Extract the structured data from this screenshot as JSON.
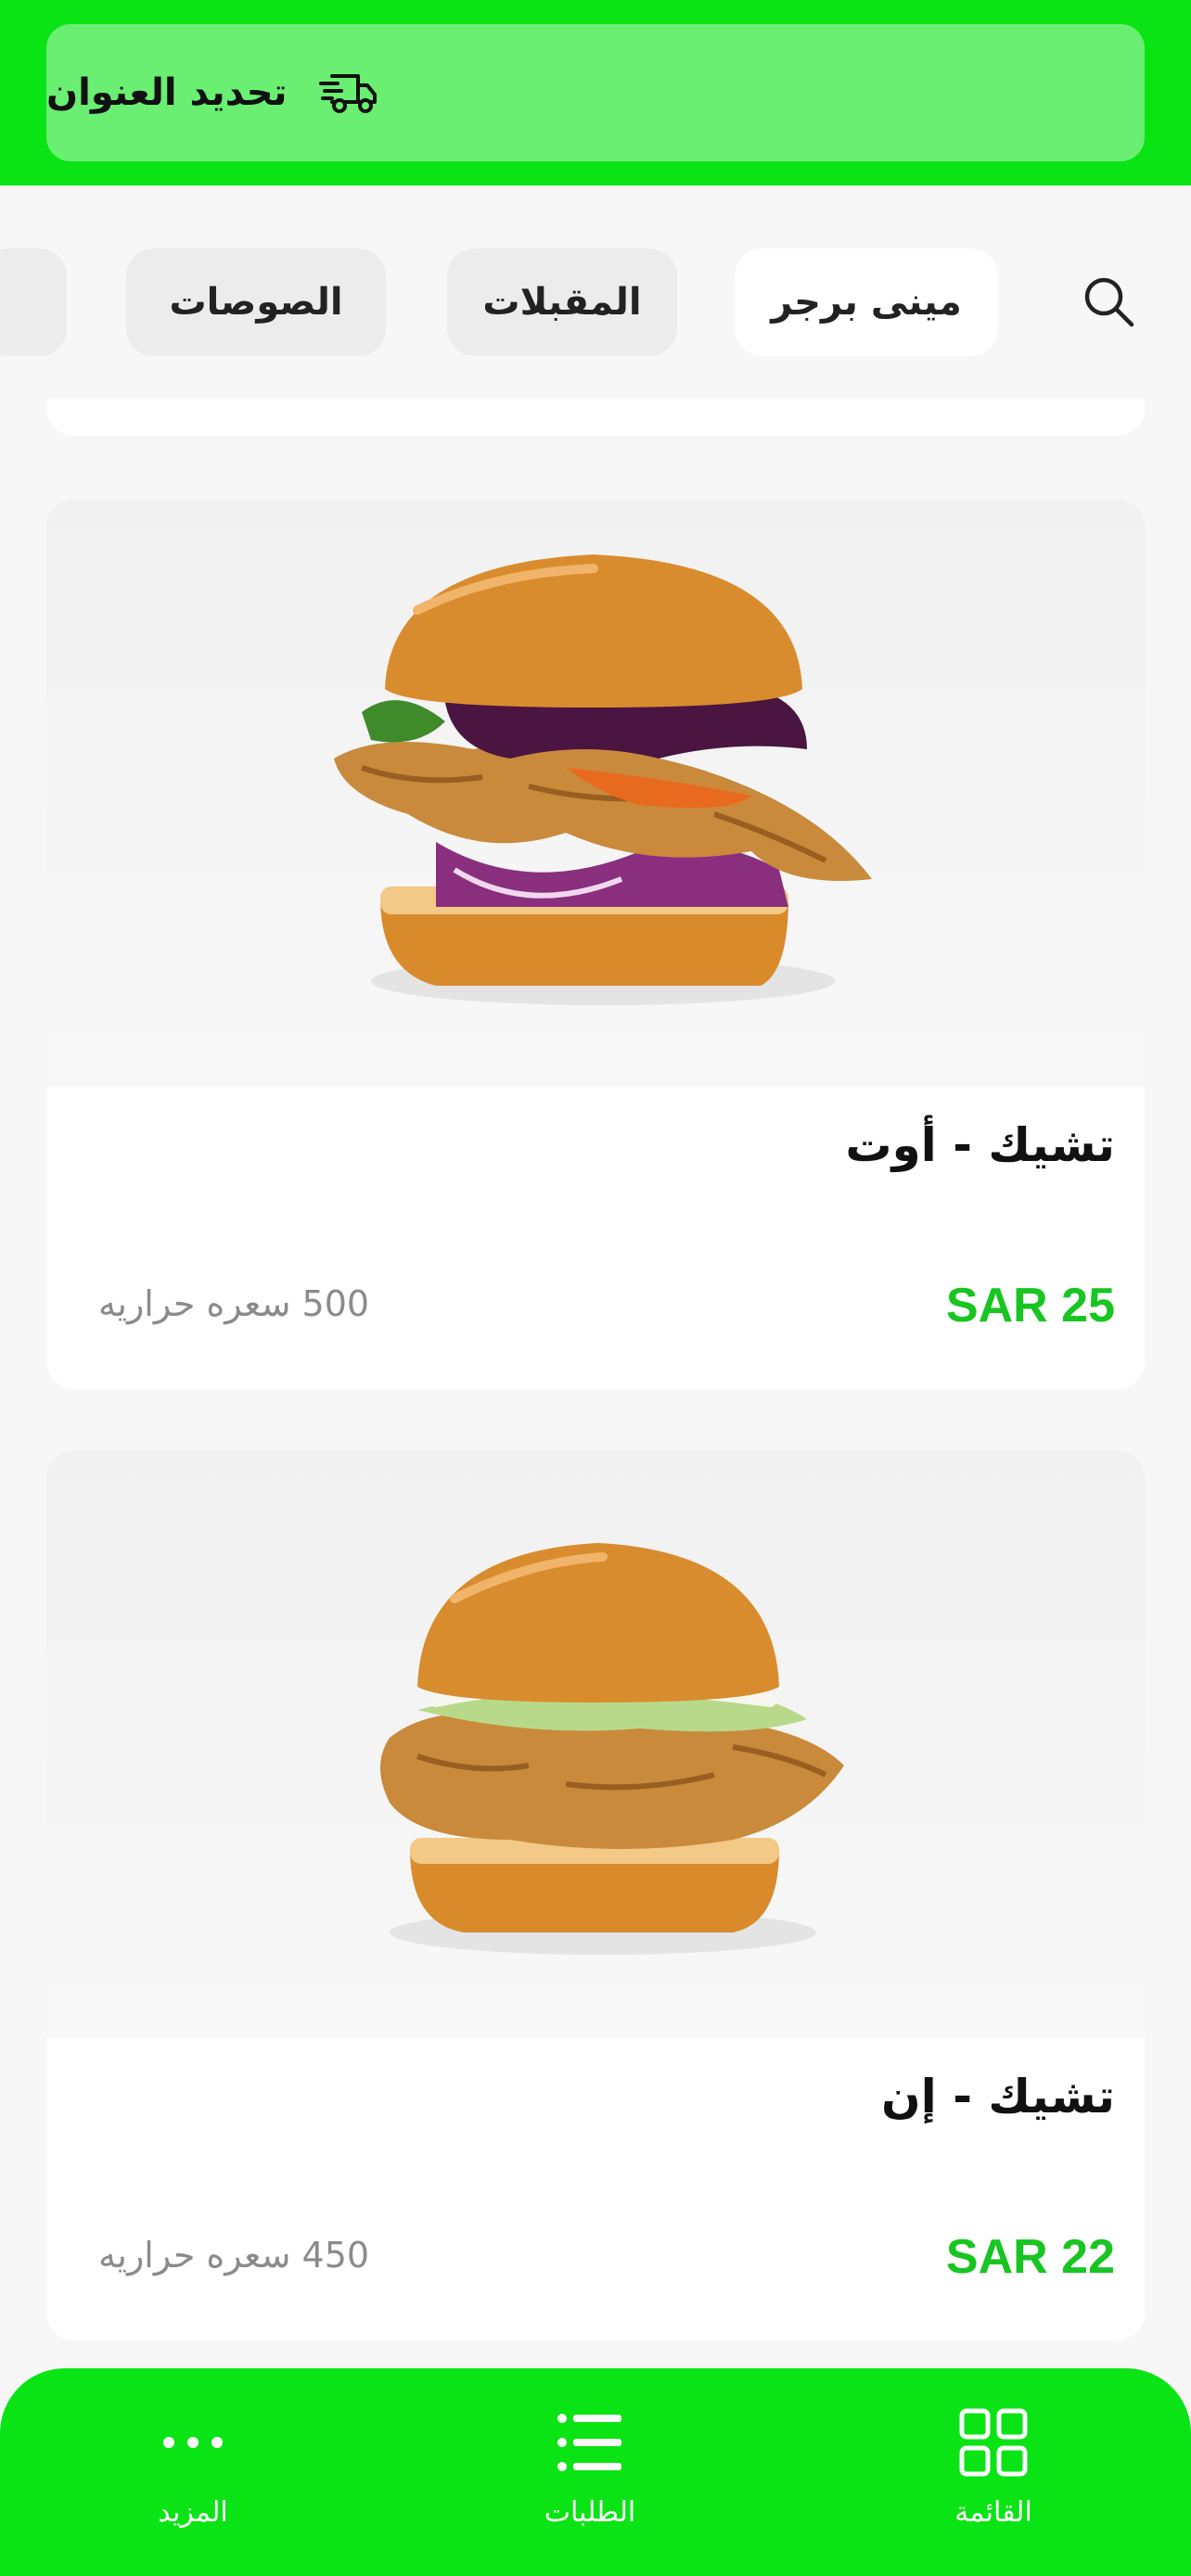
{
  "header": {
    "address_label": "تحديد العنوان",
    "icon": "delivery-truck-icon"
  },
  "categories": {
    "search_icon": "search-icon",
    "items": [
      {
        "label": "مينى برجر",
        "active": true
      },
      {
        "label": "المقبلات",
        "active": false
      },
      {
        "label": "الصوصات",
        "active": false
      }
    ]
  },
  "products": [
    {
      "name": "تشيك - أوت",
      "price": "SAR 25",
      "calories": "500 سعره حراريه",
      "image": "crispy-chicken-burger-with-red-cabbage"
    },
    {
      "name": "تشيك - إن",
      "price": "SAR 22",
      "calories": "450 سعره حراريه",
      "image": "crispy-chicken-burger-with-lettuce"
    }
  ],
  "bottom_nav": [
    {
      "label": "القائمة",
      "icon": "grid-icon",
      "active": true
    },
    {
      "label": "الطلبات",
      "icon": "list-icon",
      "active": false
    },
    {
      "label": "المزيد",
      "icon": "more-dots-icon",
      "active": false
    }
  ],
  "colors": {
    "brand_green": "#0ae414",
    "address_bar": "#6aef72",
    "price_green": "#18c521"
  }
}
